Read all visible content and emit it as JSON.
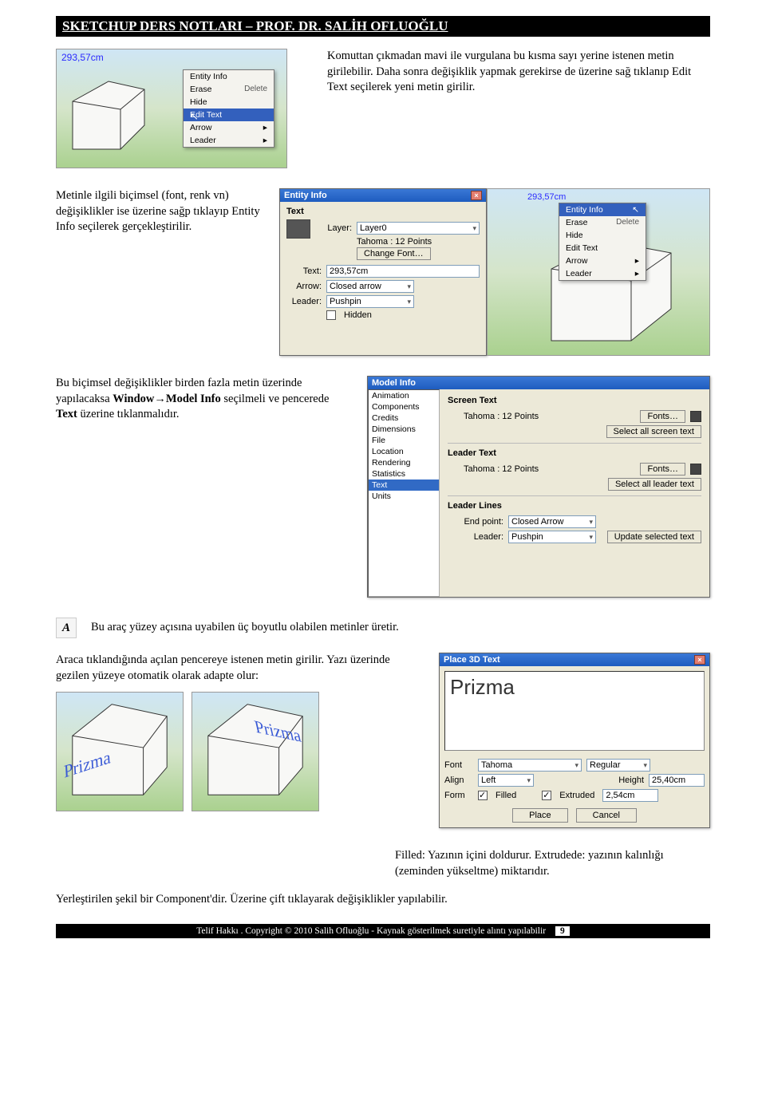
{
  "header": "SKETCHUP DERS NOTLARI – PROF. DR. SALİH OFLUOĞLU",
  "section1": {
    "dimension": "293,57cm",
    "context_menu": {
      "items": [
        "Entity Info",
        "Erase",
        "Hide",
        "Edit Text",
        "Arrow",
        "Leader"
      ],
      "selected": "Edit Text",
      "submenu_label": "Delete"
    },
    "para": "Komuttan çıkmadan mavi ile vurgulana bu kısma sayı yerine istenen metin girilebilir. Daha sonra değişiklik yapmak gerekirse de üzerine sağ tıklanıp Edit Text seçilerek yeni metin girilir."
  },
  "section2": {
    "para": "Metinle ilgili biçimsel (font, renk vn) değişiklikler ise üzerine sağp tıklayıp Entity Info seçilerek gerçekleştirilir.",
    "entity_info": {
      "title": "Entity Info",
      "type": "Text",
      "layer_label": "Layer:",
      "layer_value": "Layer0",
      "font_summary": "Tahoma : 12 Points",
      "change_font_btn": "Change Font…",
      "text_label": "Text:",
      "text_value": "293,57cm",
      "arrow_label": "Arrow:",
      "arrow_value": "Closed arrow",
      "leader_label": "Leader:",
      "leader_value": "Pushpin",
      "hidden_label": "Hidden"
    },
    "viewport_dim": "293,57cm",
    "context_menu2": {
      "items": [
        "Entity Info",
        "Erase",
        "Hide",
        "Edit Text",
        "Arrow",
        "Leader"
      ],
      "selected": "Entity Info",
      "submenu_label": "Delete"
    }
  },
  "section3": {
    "para_pre": "Bu biçimsel değişiklikler birden fazla metin üzerinde yapılacaksa ",
    "menu_path": "Window→Model Info",
    "para_mid": " seçilmeli ve  pencerede ",
    "bold_text": "Text",
    "para_post": " üzerine tıklanmalıdır.",
    "model_info": {
      "title": "Model Info",
      "sidebar": [
        "Animation",
        "Components",
        "Credits",
        "Dimensions",
        "File",
        "Location",
        "Rendering",
        "Statistics",
        "Text",
        "Units"
      ],
      "sidebar_selected": "Text",
      "screen_text_head": "Screen Text",
      "tahoma12": "Tahoma : 12 Points",
      "fonts_btn": "Fonts…",
      "select_all_screen": "Select all screen text",
      "leader_text_head": "Leader Text",
      "select_all_leader": "Select all leader text",
      "leader_lines_head": "Leader Lines",
      "endpoint_label": "End point:",
      "endpoint_value": "Closed Arrow",
      "leader_label": "Leader:",
      "leader_value": "Pushpin",
      "update_btn": "Update selected text"
    }
  },
  "section4": {
    "tool_desc": "Bu araç yüzey açısına uyabilen üç boyutlu olabilen metinler üretir.",
    "tool_icon_letter": "A",
    "para": "Araca tıklandığında açılan pencereye istenen metin girilir. Yazı üzerinde gezilen yüzeye otomatik olarak adapte olur:",
    "prism_label": "Prizma",
    "place_3d": {
      "title": "Place 3D Text",
      "text_value": "Prizma",
      "font_label": "Font",
      "font_value": "Tahoma",
      "style_value": "Regular",
      "align_label": "Align",
      "align_value": "Left",
      "height_label": "Height",
      "height_value": "25,40cm",
      "form_label": "Form",
      "filled_label": "Filled",
      "extruded_label": "Extruded",
      "extruded_value": "2,54cm",
      "place_btn": "Place",
      "cancel_btn": "Cancel"
    },
    "filled_desc": "Filled: Yazının içini doldurur. Extrudede: yazının kalınlığı (zeminden yükseltme) miktarıdır.",
    "final_para": "Yerleştirilen şekil bir Component'dir. Üzerine çift tıklayarak değişiklikler yapılabilir."
  },
  "footer": {
    "text": "Telif Hakkı . Copyright © 2010 Salih Ofluoğlu - Kaynak gösterilmek suretiyle alıntı yapılabilir",
    "page": "9"
  }
}
